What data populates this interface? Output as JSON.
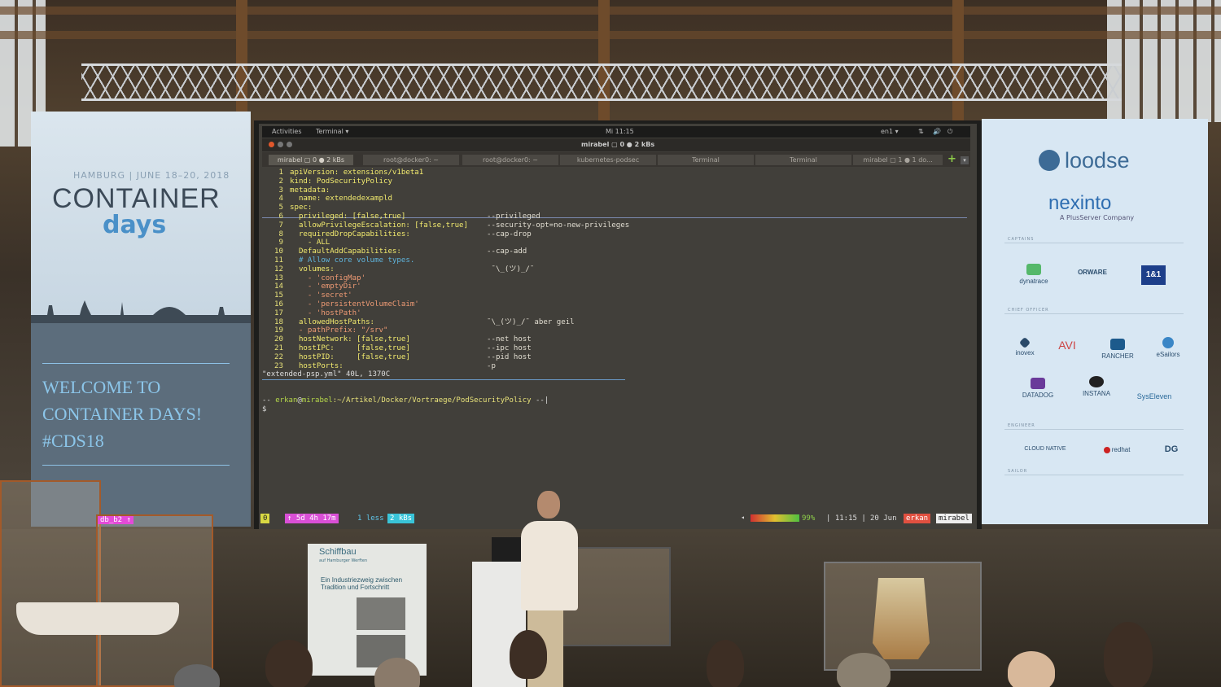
{
  "scene": "conference-talk-photo",
  "left_banner": {
    "date": "HAMBURG | JUNE 18–20, 2018",
    "title_top": "CONTAINER",
    "title_bottom": "days",
    "welcome_line1": "WELCOME TO",
    "welcome_line2": "CONTAINER DAYS!",
    "welcome_line3": "#CDS18"
  },
  "right_banner": {
    "sponsor_main": "loodse",
    "sponsor_second": "nexinto",
    "sponsor_second_sub": "A PlusServer Company",
    "section_captains": "CAPTAINS",
    "section_chief": "CHIEF OFFICER",
    "section_engineer": "ENGINEER",
    "section_sailor": "SAILOR",
    "captains": [
      "dynatrace",
      "ORWARE",
      "1&1"
    ],
    "chief_officers": [
      "inovex",
      "AVI",
      "RANCHER",
      "eSailors",
      "DATADOG",
      "INSTANA",
      "SysEleven"
    ],
    "engineers": [
      "CLOUD NATIVE",
      "redhat",
      "DG"
    ]
  },
  "desktop": {
    "activities": "Activities",
    "app": "Terminal ▾",
    "clock": "Mi 11:15",
    "lang": "en1 ▾",
    "window_title": "mirabel ▢ 0 ● 2 kBs"
  },
  "tabs": [
    {
      "label": "mirabel ▢ 0 ● 2 kBs",
      "active": true
    },
    {
      "label": "root@docker0: ~",
      "active": false
    },
    {
      "label": "root@docker0: ~",
      "active": false
    },
    {
      "label": "kubernetes-podsec",
      "active": false
    },
    {
      "label": "Terminal",
      "active": false
    },
    {
      "label": "Terminal",
      "active": false
    },
    {
      "label": "mirabel ▢ 1 ● 1 do...",
      "active": false
    }
  ],
  "code_lines": [
    {
      "n": "1",
      "code": "apiVersion: extensions/v1beta1",
      "comment": ""
    },
    {
      "n": "2",
      "code": "kind: PodSecurityPolicy",
      "comment": ""
    },
    {
      "n": "3",
      "code": "metadata:",
      "comment": ""
    },
    {
      "n": "4",
      "code": "  name: extendedexampld",
      "comment": ""
    },
    {
      "n": "5",
      "code": "spec:",
      "comment": ""
    },
    {
      "n": "6",
      "code": "  privileged: [false,true]",
      "comment": "--privileged"
    },
    {
      "n": "7",
      "code": "  allowPrivilegeEscalation: [false,true]",
      "comment": "--security-opt=no-new-privileges"
    },
    {
      "n": "8",
      "code": "  requiredDropCapabilities:",
      "comment": "--cap-drop"
    },
    {
      "n": "9",
      "code": "    - ALL",
      "comment": ""
    },
    {
      "n": "10",
      "code": "  DefaultAddCapabilities:",
      "comment": "--cap-add"
    },
    {
      "n": "11",
      "code": "  # Allow core volume types.",
      "comment": ""
    },
    {
      "n": "12",
      "code": "  volumes:",
      "comment": " ¯\\_(ツ)_/¯"
    },
    {
      "n": "13",
      "code": "    - 'configMap'",
      "comment": ""
    },
    {
      "n": "14",
      "code": "    - 'emptyDir'",
      "comment": ""
    },
    {
      "n": "15",
      "code": "    - 'secret'",
      "comment": ""
    },
    {
      "n": "16",
      "code": "    - 'persistentVolumeClaim'",
      "comment": ""
    },
    {
      "n": "17",
      "code": "    - 'hostPath'",
      "comment": ""
    },
    {
      "n": "18",
      "code": "  allowedHostPaths:",
      "comment": "¯\\_(ツ)_/¯ aber geil"
    },
    {
      "n": "19",
      "code": "  - pathPrefix: \"/srv\"",
      "comment": ""
    },
    {
      "n": "20",
      "code": "  hostNetwork: [false,true]",
      "comment": "--net host"
    },
    {
      "n": "21",
      "code": "  hostIPC:     [false,true]",
      "comment": "--ipc host"
    },
    {
      "n": "22",
      "code": "  hostPID:     [false,true]",
      "comment": "--pid host"
    },
    {
      "n": "23",
      "code": "  hostPorts:",
      "comment": "-p"
    }
  ],
  "file_status": "\"extended-psp.yml\" 40L, 1370C",
  "prompt": {
    "prefix": "-- ",
    "user": "erkan",
    "at": "@",
    "host": "mirabel",
    "path": ":~/Artikel/Docker/Vortraege/PodSecurityPolicy",
    "suffix": " --|",
    "dollar": "$"
  },
  "tmux_left": [
    "0",
    "↑ 5d 4h 17m",
    "1 less",
    "2 kBs"
  ],
  "tmux_right": {
    "battery": "99%",
    "time": "11:15",
    "date": "20 Jun",
    "user": "erkan",
    "host": "mirabel"
  },
  "showcase_label": "db_b2 ↑",
  "exhibit_sign": {
    "title": "Schiffbau",
    "subtitle": "auf Hamburger Werften",
    "heading": "Ein Industriezweig zwischen Tradition und Fortschritt"
  },
  "colors": {
    "yaml_key": "#f2ea6e",
    "string": "#ee9a74",
    "comment": "#5fb4dc",
    "prompt_user": "#b6d84a",
    "banner_blue": "#4a90c8"
  }
}
